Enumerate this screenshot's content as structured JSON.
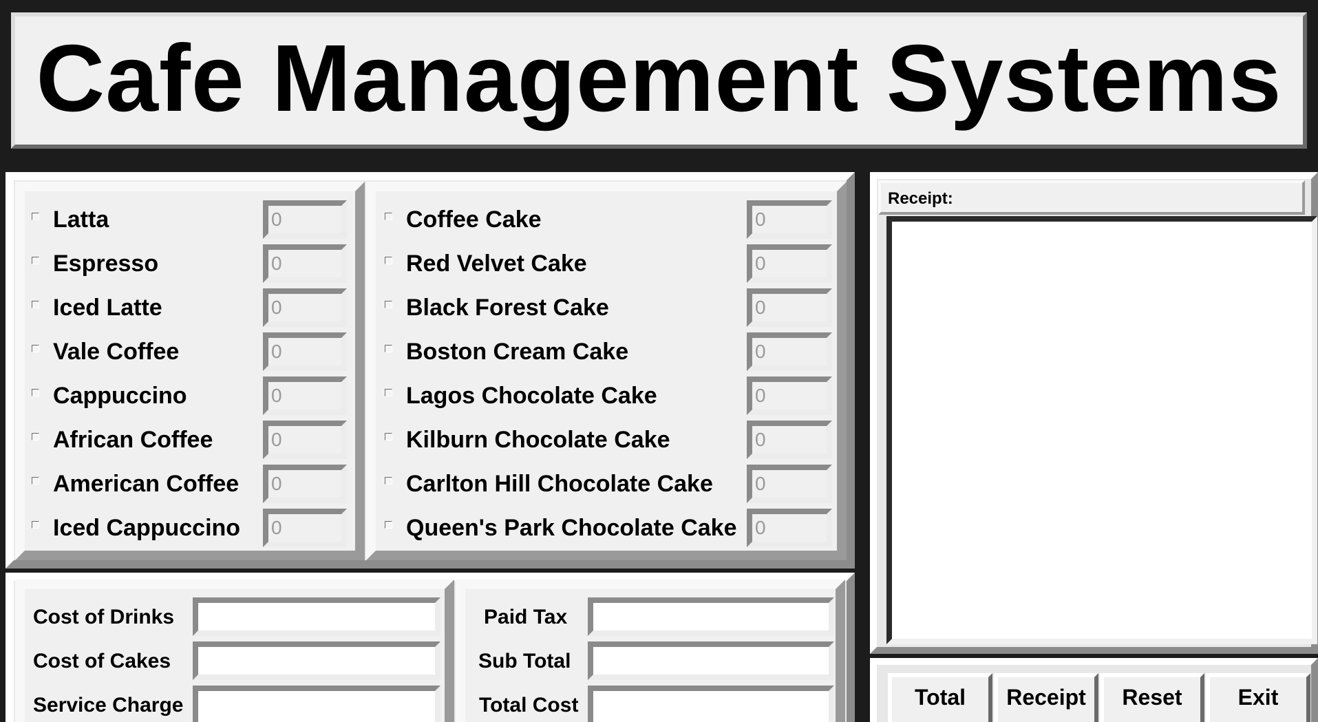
{
  "app": {
    "title": "Cafe Management Systems"
  },
  "drinks": [
    {
      "label": "Latta",
      "qty": "0"
    },
    {
      "label": "Espresso",
      "qty": "0"
    },
    {
      "label": "Iced Latte",
      "qty": "0"
    },
    {
      "label": "Vale Coffee",
      "qty": "0"
    },
    {
      "label": "Cappuccino",
      "qty": "0"
    },
    {
      "label": "African Coffee",
      "qty": "0"
    },
    {
      "label": "American Coffee",
      "qty": "0"
    },
    {
      "label": "Iced Cappuccino",
      "qty": "0"
    }
  ],
  "cakes": [
    {
      "label": "Coffee Cake",
      "qty": "0"
    },
    {
      "label": "Red Velvet Cake",
      "qty": "0"
    },
    {
      "label": "Black Forest Cake",
      "qty": "0"
    },
    {
      "label": "Boston Cream Cake",
      "qty": "0"
    },
    {
      "label": "Lagos Chocolate Cake",
      "qty": "0"
    },
    {
      "label": "Kilburn Chocolate Cake",
      "qty": "0"
    },
    {
      "label": "Carlton Hill Chocolate Cake",
      "qty": "0"
    },
    {
      "label": "Queen's Park Chocolate Cake",
      "qty": "0"
    }
  ],
  "costs": {
    "drinks_label": "Cost of Drinks",
    "drinks_value": "",
    "cakes_label": "Cost of Cakes",
    "cakes_value": "",
    "service_label": "Service Charge",
    "service_value": "",
    "tax_label": "Paid Tax",
    "tax_value": "",
    "subtotal_label": "Sub Total",
    "subtotal_value": "",
    "total_label": "Total Cost",
    "total_value": ""
  },
  "receipt": {
    "label": "Receipt:",
    "text": ""
  },
  "buttons": {
    "total": "Total",
    "receipt": "Receipt",
    "reset": "Reset",
    "exit": "Exit"
  }
}
